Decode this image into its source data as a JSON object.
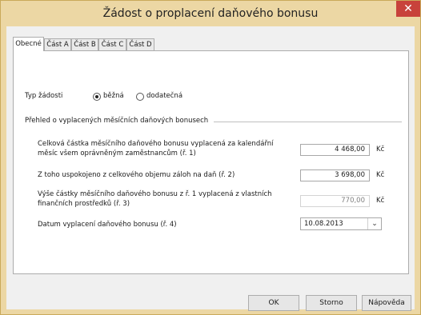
{
  "window": {
    "title": "Žádost o proplacení daňového bonusu",
    "close_symbol": "✕"
  },
  "tabs": [
    {
      "label": "Obecné",
      "active": true
    },
    {
      "label": "Část A",
      "active": false
    },
    {
      "label": "Část B",
      "active": false
    },
    {
      "label": "Část C",
      "active": false
    },
    {
      "label": "Část D",
      "active": false
    }
  ],
  "request_type": {
    "label": "Typ žádosti",
    "options": [
      {
        "label": "běžná",
        "selected": true
      },
      {
        "label": "dodatečná",
        "selected": false
      }
    ]
  },
  "overview": {
    "group_label": "Přehled o vyplacených měsíčních daňových bonusech",
    "rows": [
      {
        "label_line1": "Celková částka měsíčního daňového bonusu vyplacená za kalendářní",
        "label_line2": "měsíc všem oprávněným zaměstnancům (ř. 1)",
        "value": "4 468,00",
        "unit": "Kč",
        "readonly": false
      },
      {
        "label_line1": "Z toho uspokojeno z celkového objemu záloh na daň (ř. 2)",
        "value": "3 698,00",
        "unit": "Kč",
        "readonly": false
      },
      {
        "label_line1": "Výše částky měsíčního daňového bonusu z ř. 1 vyplacená z vlastních",
        "label_line2": "finančních prostředků (ř. 3)",
        "value": "770,00",
        "unit": "Kč",
        "readonly": true
      }
    ],
    "date": {
      "label": "Datum vyplacení daňového bonusu (ř. 4)",
      "value": "10.08.2013",
      "dropdown_icon": "chevron-down-icon"
    }
  },
  "buttons": {
    "ok": "OK",
    "cancel": "Storno",
    "help": "Nápověda"
  },
  "colors": {
    "frame": "#ecd7a4",
    "close": "#c8423b",
    "panel": "#ffffff",
    "client": "#f0f0f0"
  }
}
